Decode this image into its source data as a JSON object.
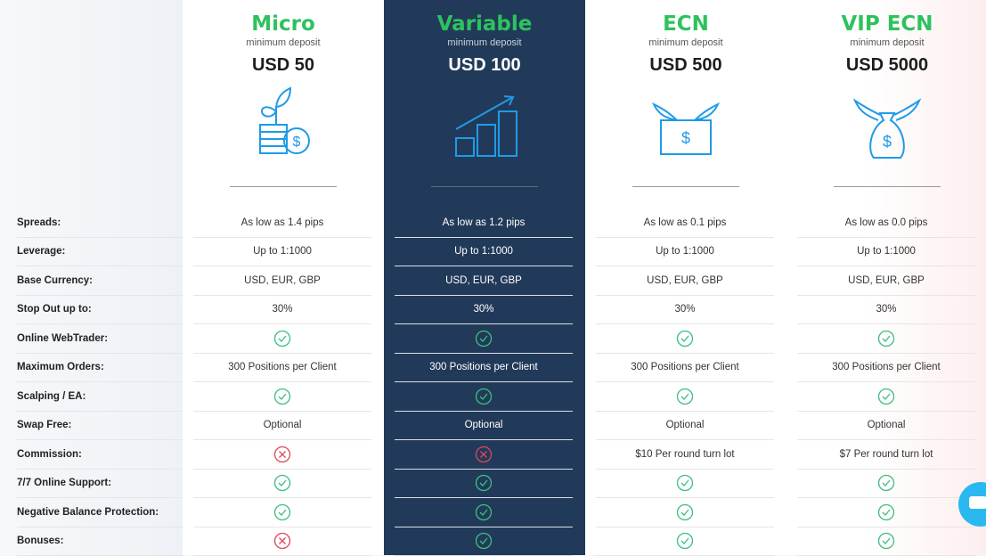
{
  "features": [
    "Spreads:",
    "Leverage:",
    "Base Currency:",
    "Stop Out up to:",
    "Online WebTrader:",
    "Maximum Orders:",
    "Scalping / EA:",
    "Swap Free:",
    "Commission:",
    "7/7 Online Support:",
    "Negative Balance Protection:",
    "Bonuses:"
  ],
  "colors": {
    "accent_green": "#2ec25e",
    "dark_column": "#223a59",
    "icon_blue": "#1e9be8",
    "check": "#3cbf7f",
    "cross": "#e0475a"
  },
  "plans": [
    {
      "name": "Micro",
      "subtitle": "minimum deposit",
      "price": "USD 50",
      "icon": "plant-coins-icon",
      "values": [
        "As low as 1.4 pips",
        "Up to 1:1000",
        "USD, EUR, GBP",
        "30%",
        "check",
        "300 Positions per Client",
        "check",
        "Optional",
        "cross",
        "check",
        "check",
        "cross"
      ]
    },
    {
      "name": "Variable",
      "subtitle": "minimum deposit",
      "price": "USD 100",
      "icon": "growth-coins-icon",
      "values": [
        "As low as 1.2 pips",
        "Up to 1:1000",
        "USD, EUR, GBP",
        "30%",
        "check",
        "300 Positions per Client",
        "check",
        "Optional",
        "cross",
        "check",
        "check",
        "check"
      ]
    },
    {
      "name": "ECN",
      "subtitle": "minimum deposit",
      "price": "USD 500",
      "icon": "winged-banknote-icon",
      "values": [
        "As low as 0.1 pips",
        "Up to 1:1000",
        "USD, EUR, GBP",
        "30%",
        "check",
        "300 Positions per Client",
        "check",
        "Optional",
        "$10 Per round turn lot",
        "check",
        "check",
        "check"
      ]
    },
    {
      "name": "VIP ECN",
      "subtitle": "minimum deposit",
      "price": "USD 5000",
      "icon": "winged-money-bag-icon",
      "values": [
        "As low as 0.0 pips",
        "Up to 1:1000",
        "USD, EUR, GBP",
        "30%",
        "check",
        "300 Positions per Client",
        "check",
        "Optional",
        "$7 Per round turn lot",
        "check",
        "check",
        "check"
      ]
    }
  ]
}
